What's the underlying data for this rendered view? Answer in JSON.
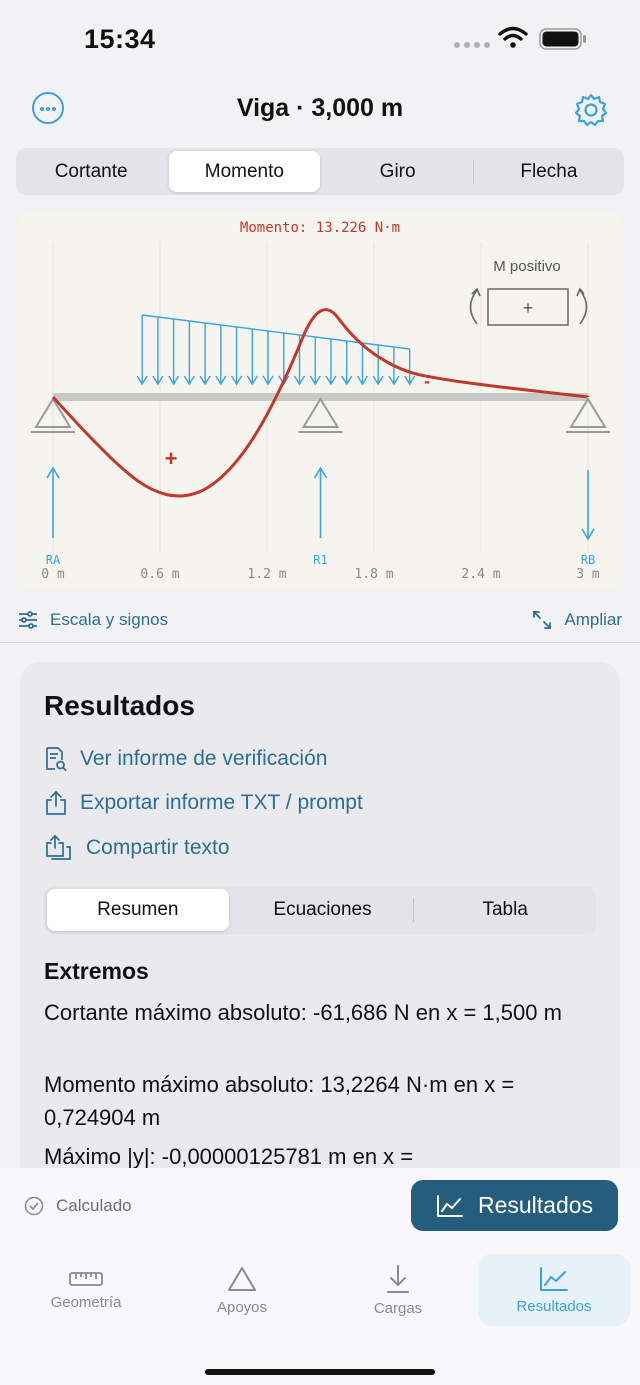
{
  "status": {
    "time": "15:34"
  },
  "nav": {
    "title": "Viga · 3,000 m"
  },
  "diagram_tabs": [
    "Cortante",
    "Momento",
    "Giro",
    "Flecha"
  ],
  "diagram_active": 1,
  "chart_data": {
    "type": "line",
    "title": "Momento: 13.226 N·m",
    "legend_label": "M positivo",
    "legend_box": "+",
    "x_ticks": [
      "0 m",
      "0.6 m",
      "1.2 m",
      "1.8 m",
      "2.4 m",
      "3 m"
    ],
    "support_labels": [
      "RA",
      "R1",
      "RB"
    ],
    "sign_plus": "+",
    "sign_minus": "-",
    "curve": [
      {
        "x": 0.0,
        "y": 0.0
      },
      {
        "x": 0.2,
        "y": -5.0
      },
      {
        "x": 0.4,
        "y": -9.5
      },
      {
        "x": 0.55,
        "y": -12.0
      },
      {
        "x": 0.72,
        "y": -13.0
      },
      {
        "x": 0.9,
        "y": -11.5
      },
      {
        "x": 1.1,
        "y": -6.5
      },
      {
        "x": 1.3,
        "y": 2.0
      },
      {
        "x": 1.5,
        "y": 13.2
      },
      {
        "x": 1.7,
        "y": 7.0
      },
      {
        "x": 1.95,
        "y": 3.3
      },
      {
        "x": 2.2,
        "y": 2.2
      },
      {
        "x": 2.5,
        "y": 1.3
      },
      {
        "x": 3.0,
        "y": 0.0
      }
    ],
    "distributed_load": {
      "x_start": 0.5,
      "x_end": 2.0
    },
    "xlim": [
      0,
      3
    ],
    "colors": {
      "curve": "#c0392b",
      "load": "#3aa3d8",
      "beam": "#c8c8c8",
      "support": "#9a9a9a",
      "title": "#c0392b"
    }
  },
  "toolbar": {
    "scale_label": "Escala y signos",
    "expand_label": "Ampliar"
  },
  "results": {
    "heading": "Resultados",
    "links": [
      "Ver informe de verificación",
      "Exportar informe TXT / prompt",
      "Compartir texto"
    ],
    "tabs": [
      "Resumen",
      "Ecuaciones",
      "Tabla"
    ],
    "active_tab": 0,
    "section": "Extremos",
    "lines": [
      "Cortante máximo absoluto: -61,686 N en x = 1,500 m",
      "Momento máximo absoluto: 13,2264 N·m en x = 0,724904 m",
      "Máximo |y|: -0,00000125781 m en x ="
    ]
  },
  "bottom": {
    "status": "Calculado",
    "results_button": "Resultados",
    "tabs": [
      "Geometría",
      "Apoyos",
      "Cargas",
      "Resultados"
    ],
    "active_tab": 3
  }
}
